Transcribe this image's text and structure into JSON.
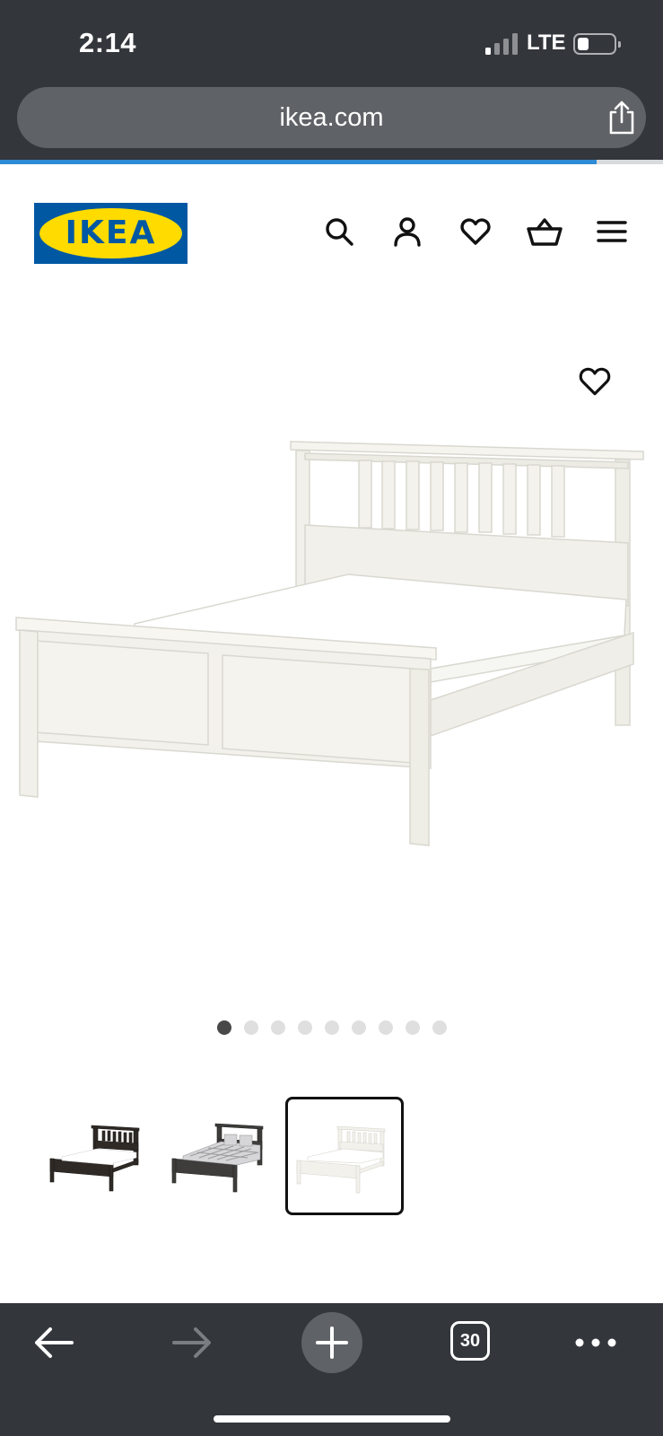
{
  "status_bar": {
    "time": "2:14",
    "carrier": "LTE",
    "signal_bars_filled": 1,
    "signal_bars_total": 4
  },
  "browser": {
    "url": "ikea.com",
    "load_progress": 0.9,
    "tab_count": "30",
    "accent_color": "#2e8bd6",
    "chrome_color": "#33363b"
  },
  "site": {
    "logo_text": "IKEA",
    "brand_blue": "#0058a3",
    "brand_yellow": "#ffdb00",
    "header_icons": [
      "search-icon",
      "account-icon",
      "heart-icon",
      "basket-icon",
      "menu-icon"
    ]
  },
  "product": {
    "gallery_total": 9,
    "gallery_active_index": 0,
    "variants": [
      {
        "name": "black-brown",
        "color": "#2f2a26"
      },
      {
        "name": "dark-grey",
        "color": "#3e3d3c"
      },
      {
        "name": "white",
        "color": "#f2f1ec",
        "selected": true
      }
    ]
  }
}
